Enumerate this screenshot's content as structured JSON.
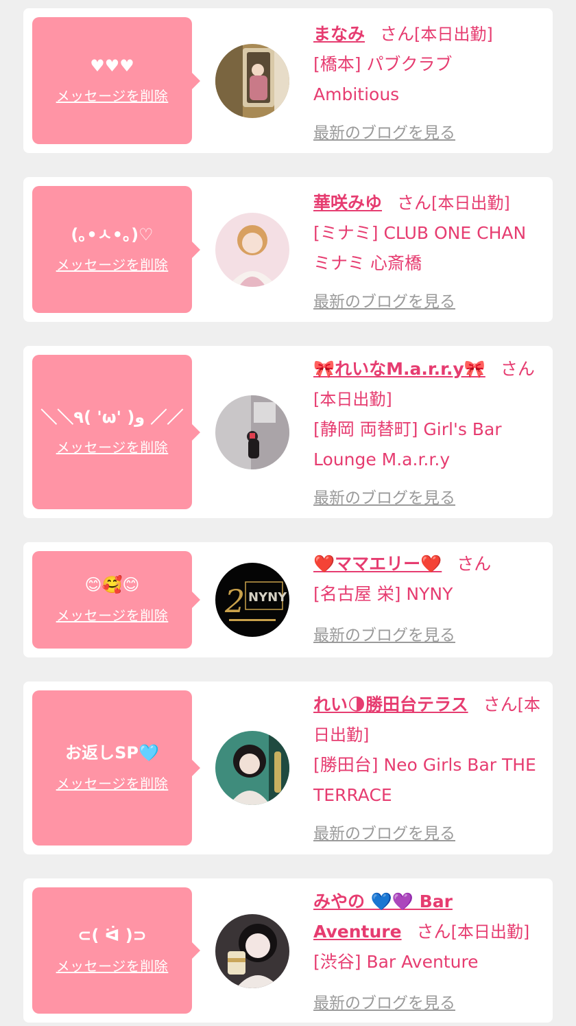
{
  "common": {
    "delete_label": "メッセージを削除",
    "san": "さん",
    "attendance": "[本日出勤]",
    "blog_label": "最新のブログを見る"
  },
  "colors": {
    "background": "#efefef",
    "bubble": "#ff94a5",
    "accent": "#e63c70",
    "muted": "#9a9a9a"
  },
  "entries": [
    {
      "message": "♥♥♥",
      "name": "まなみ",
      "attendance_shown": true,
      "store": "[橋本] パブクラブ Ambitious",
      "avatar_icon": "mirror-selfie-photo"
    },
    {
      "message": "(｡•ㅅ•｡)♡",
      "name": "華咲みゆ",
      "attendance_shown": true,
      "store": "[ミナミ] CLUB ONE CHAN ミナミ 心斎橋",
      "avatar_icon": "portrait-photo"
    },
    {
      "message": "＼＼٩( 'ω' )و ／／",
      "name": "🎀れいなM.a.r.r.y🎀",
      "attendance_shown": true,
      "store": "[静岡 両替町] Girl's Bar Lounge M.a.r.r.y",
      "avatar_icon": "wall-photo"
    },
    {
      "message": "😊🥰😊",
      "name": "❤️ママエリー❤️",
      "attendance_shown": false,
      "store": "[名古屋 栄] NYNY",
      "avatar_icon": "nyny-logo"
    },
    {
      "message": "お返しSP🩵",
      "name": "れい🌗勝田台テラス",
      "attendance_shown": true,
      "store": "[勝田台] Neo Girls Bar THE TERRACE",
      "avatar_icon": "portrait-photo"
    },
    {
      "message": "⊂( ᐛ )⊃",
      "name": "みやの 💙💜 Bar Aventure",
      "attendance_shown": true,
      "store": "[渋谷] Bar Aventure",
      "avatar_icon": "selfie-cup-photo"
    }
  ]
}
